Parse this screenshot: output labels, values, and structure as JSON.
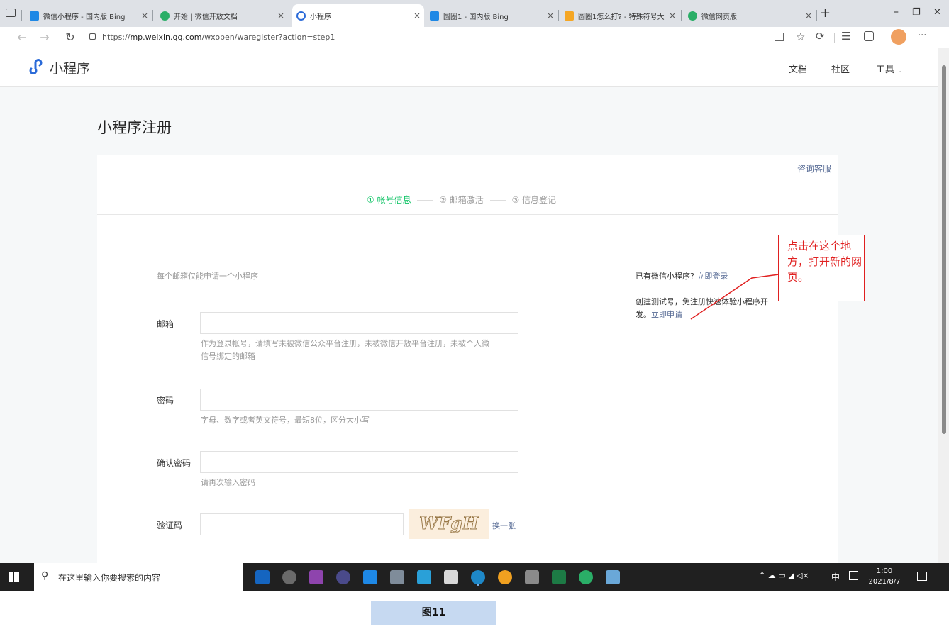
{
  "browser": {
    "tabs": [
      {
        "label": "微信小程序 - 国内版 Bing",
        "color": "#1e88e5"
      },
      {
        "label": "开始 | 微信开放文档",
        "color": "#2aae67"
      },
      {
        "label": "小程序",
        "color": "#2a6ad8"
      },
      {
        "label": "圆圈1 - 国内版 Bing",
        "color": "#1e88e5"
      },
      {
        "label": "圆圈1怎么打? - 特殊符号大全",
        "color": "#f5a623"
      },
      {
        "label": "微信网页版",
        "color": "#2aae67"
      }
    ],
    "url_prefix": "https://",
    "url_domain": "mp.weixin.qq.com",
    "url_path": "/wxopen/waregister?action=step1",
    "min": "–",
    "restore": "❐",
    "close": "✕",
    "new_tab": "+",
    "more": "···"
  },
  "nav": {
    "brand": "小程序",
    "links": [
      "文档",
      "社区"
    ],
    "tools": "工具",
    "brand_color": "#2a6ad8"
  },
  "main": {
    "page_title": "小程序注册",
    "consult": "咨询客服",
    "steps": [
      "① 帐号信息",
      "② 邮箱激活",
      "③ 信息登记"
    ],
    "notice": "每个邮箱仅能申请一个小程序",
    "fields": {
      "email_label": "邮箱",
      "email_hint_1": "作为登录帐号，请填写未被微信公众平台注册，未被微信开放平台注册，未被个人微",
      "email_hint_2": "信号绑定的邮箱",
      "password_label": "密码",
      "password_hint": "字母、数字或者英文符号，最短8位，区分大小写",
      "confirm_label": "确认密码",
      "confirm_hint": "请再次输入密码",
      "captcha_label": "验证码",
      "captcha_text": "WFgH",
      "captcha_refresh": "换一张"
    },
    "side": {
      "has_account": "已有微信小程序?",
      "login_link": "立即登录",
      "test_text_1": "创建测试号，免注册快速体验小程序开",
      "test_text_2": "发。",
      "apply_link": "立即申请"
    },
    "annotation": "点击在这个地方，打开新的网页。",
    "accent_green": "#07c160",
    "link_blue": "#576b95",
    "annotation_red": "#e02020"
  },
  "taskbar": {
    "search_placeholder": "在这里输入你要搜索的内容",
    "time": "1:00",
    "date": "2021/8/7",
    "ime": "中",
    "tray": "^ ☁ ▭ ◢ ◁×"
  },
  "caption": "图11"
}
